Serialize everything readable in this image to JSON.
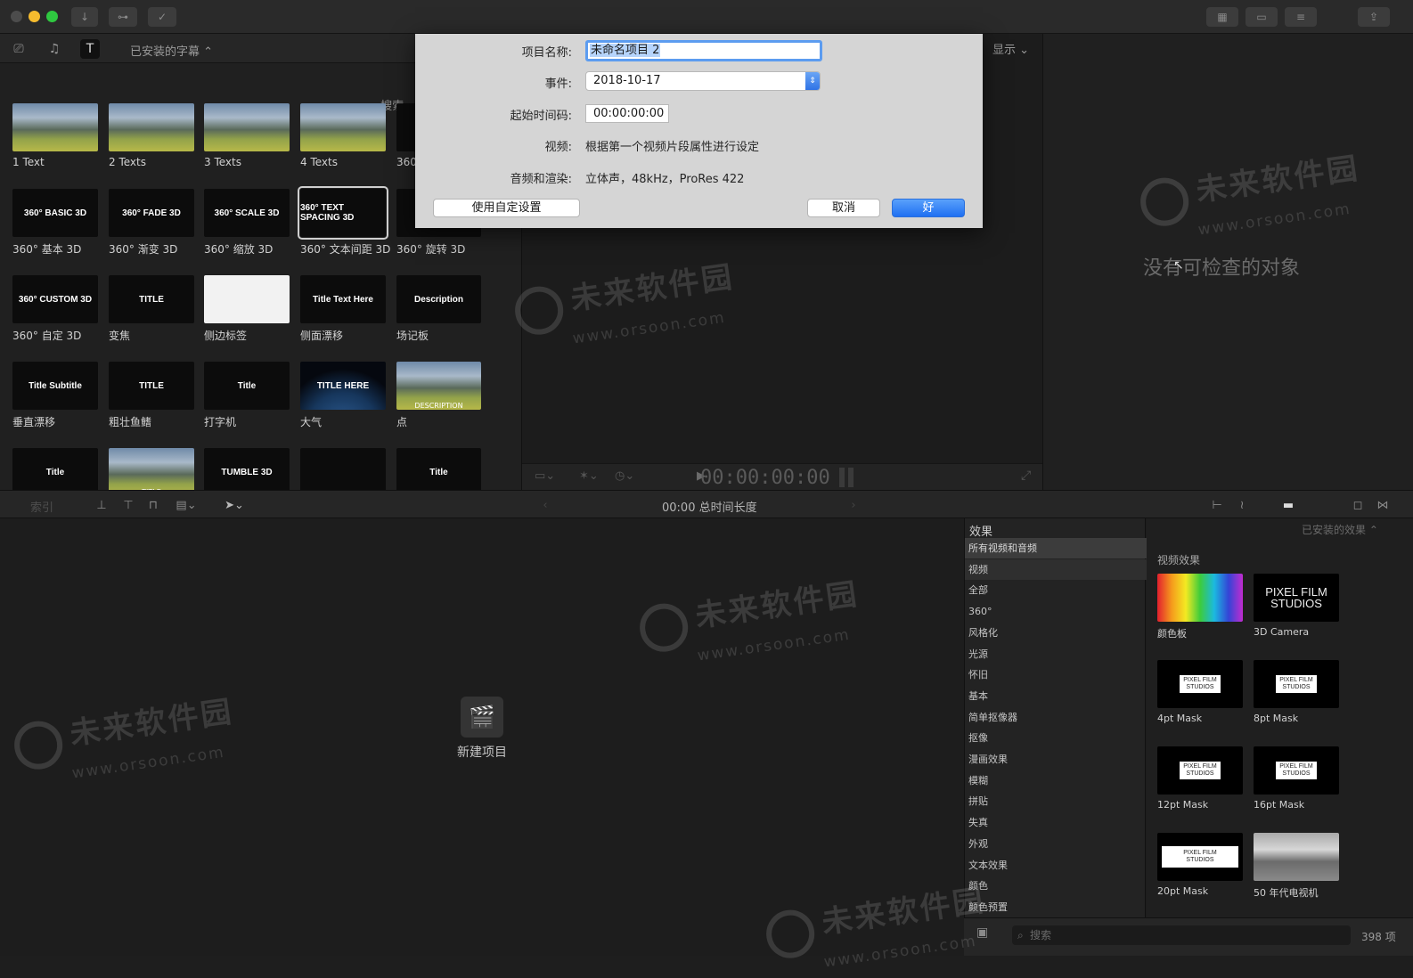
{
  "window": {
    "traffic_lights": [
      "#f25f57",
      "#f6bb2e",
      "#2fc840"
    ],
    "toolbar_left": [
      "download-icon",
      "key-icon",
      "check-icon"
    ],
    "toolbar_right": [
      "grid-icon",
      "film-icon",
      "sliders-icon",
      "share-icon"
    ]
  },
  "browser": {
    "library_select": "已安装的字幕 ⌃",
    "search_placeholder": "搜索",
    "tiles": [
      {
        "label": "1 Text",
        "style": "mountain",
        "text": ""
      },
      {
        "label": "2 Texts",
        "style": "mountain",
        "text": ""
      },
      {
        "label": "3 Texts",
        "style": "mountain",
        "text": ""
      },
      {
        "label": "4 Texts",
        "style": "mountain",
        "text": ""
      },
      {
        "label": "360",
        "style": "black",
        "text": ""
      },
      {
        "label": "360° 基本 3D",
        "style": "black",
        "text": "360° BASIC 3D"
      },
      {
        "label": "360° 渐变 3D",
        "style": "black",
        "text": "360° FADE 3D"
      },
      {
        "label": "360° 缩放 3D",
        "style": "black",
        "text": "360° SCALE 3D"
      },
      {
        "label": "360° 文本间距 3D",
        "style": "black",
        "text": "360° TEXT SPACING 3D"
      },
      {
        "label": "360° 旋转 3D",
        "style": "black",
        "text": ""
      },
      {
        "label": "360° 自定 3D",
        "style": "black",
        "text": "360° CUSTOM 3D"
      },
      {
        "label": "变焦",
        "style": "black",
        "text": "TITLE"
      },
      {
        "label": "侧边标签",
        "style": "white",
        "text": ""
      },
      {
        "label": "侧面漂移",
        "style": "black",
        "text": "Title Text Here"
      },
      {
        "label": "场记板",
        "style": "black",
        "text": "Description"
      },
      {
        "label": "垂直漂移",
        "style": "black",
        "text": "Title Subtitle"
      },
      {
        "label": "粗壮鱼鳍",
        "style": "black",
        "text": "TITLE"
      },
      {
        "label": "打字机",
        "style": "black",
        "text": "Title"
      },
      {
        "label": "大气",
        "style": "earth",
        "text": "TITLE HERE"
      },
      {
        "label": "点",
        "style": "mountain",
        "text": "DESCRIPTION"
      },
      {
        "label": "",
        "style": "black",
        "text": "Title"
      },
      {
        "label": "",
        "style": "mountain",
        "text": "TITLE"
      },
      {
        "label": "",
        "style": "black",
        "text": "TUMBLE 3D"
      },
      {
        "label": "",
        "style": "black",
        "text": ""
      },
      {
        "label": "",
        "style": "black",
        "text": "Title"
      }
    ]
  },
  "dialog": {
    "name_label": "项目名称:",
    "name_value": "未命名项目 2",
    "event_label": "事件:",
    "event_value": "2018-10-17",
    "start_tc_label": "起始时间码:",
    "start_tc_value": "00:00:00:00",
    "video_label": "视频:",
    "video_value": "根据第一个视频片段属性进行设定",
    "audio_label": "音频和渲染:",
    "audio_value": "立体声，48kHz，ProRes 422",
    "custom_btn": "使用自定设置",
    "cancel_btn": "取消",
    "ok_btn": "好"
  },
  "viewer": {
    "display_menu": "显示 ⌄",
    "timecode": "00:00:00:00"
  },
  "inspector": {
    "empty_text": "没有可检查的对象"
  },
  "timeline": {
    "index_label": "索引",
    "duration": "00:00 总时间长度",
    "new_project": "新建项目"
  },
  "effects": {
    "title": "效果",
    "library_select": "已安装的效果 ⌃",
    "heading": "视频效果",
    "categories": [
      "所有视频和音频",
      "视频",
      "全部",
      "360°",
      "风格化",
      "光源",
      "怀旧",
      "基本",
      "简单抠像器",
      "抠像",
      "漫画效果",
      "模糊",
      "拼贴",
      "失真",
      "外观",
      "文本效果",
      "颜色",
      "颜色预置"
    ],
    "items": [
      {
        "label": "颜色板",
        "style": "rainbow"
      },
      {
        "label": "3D Camera",
        "style": "pfs"
      },
      {
        "label": "4pt Mask",
        "style": "mask"
      },
      {
        "label": "8pt Mask",
        "style": "mask"
      },
      {
        "label": "12pt Mask",
        "style": "mask"
      },
      {
        "label": "16pt Mask",
        "style": "mask"
      },
      {
        "label": "20pt Mask",
        "style": "mask20"
      },
      {
        "label": "50 年代电视机",
        "style": "bw"
      }
    ],
    "search_placeholder": "搜索",
    "count": "398 项"
  },
  "watermark": {
    "main": "未来软件园",
    "url": "www.orsoon.com"
  }
}
